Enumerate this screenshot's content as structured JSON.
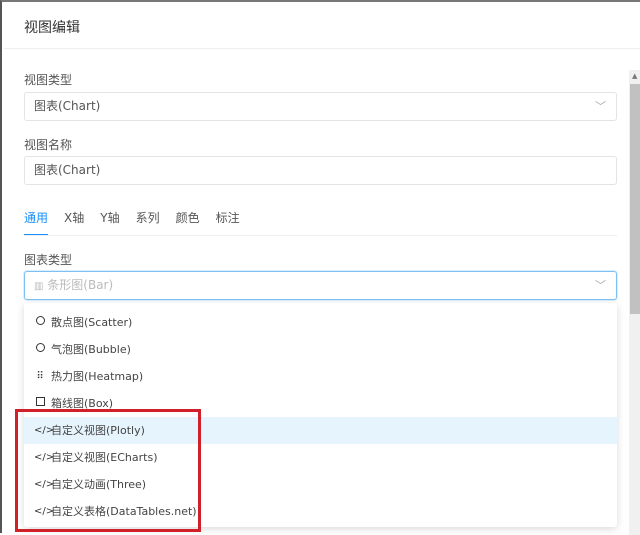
{
  "dialog": {
    "title": "视图编辑"
  },
  "view_type": {
    "label": "视图类型",
    "value": "图表(Chart)"
  },
  "view_name": {
    "label": "视图名称",
    "value": "图表(Chart)"
  },
  "tabs": [
    {
      "label": "通用",
      "active": true
    },
    {
      "label": "X轴"
    },
    {
      "label": "Y轴"
    },
    {
      "label": "系列"
    },
    {
      "label": "颜色"
    },
    {
      "label": "标注"
    }
  ],
  "chart_type": {
    "label": "图表类型",
    "value": "条形图(Bar)",
    "icon": "bar-chart-icon"
  },
  "options": [
    {
      "label": "散点图(Scatter)",
      "icon": "circle-icon"
    },
    {
      "label": "气泡图(Bubble)",
      "icon": "circle-icon"
    },
    {
      "label": "热力图(Heatmap)",
      "icon": "grid-icon"
    },
    {
      "label": "箱线图(Box)",
      "icon": "square-icon"
    },
    {
      "label": "自定义视图(Plotly)",
      "icon": "code-icon",
      "highlighted": true
    },
    {
      "label": "自定义视图(ECharts)",
      "icon": "code-icon"
    },
    {
      "label": "自定义动画(Three)",
      "icon": "code-icon"
    },
    {
      "label": "自定义表格(DataTables.net)",
      "icon": "code-icon"
    }
  ],
  "colors": {
    "accent": "#1890ff",
    "highlight": "#e6f5fd",
    "annotation": "#d0202a"
  }
}
